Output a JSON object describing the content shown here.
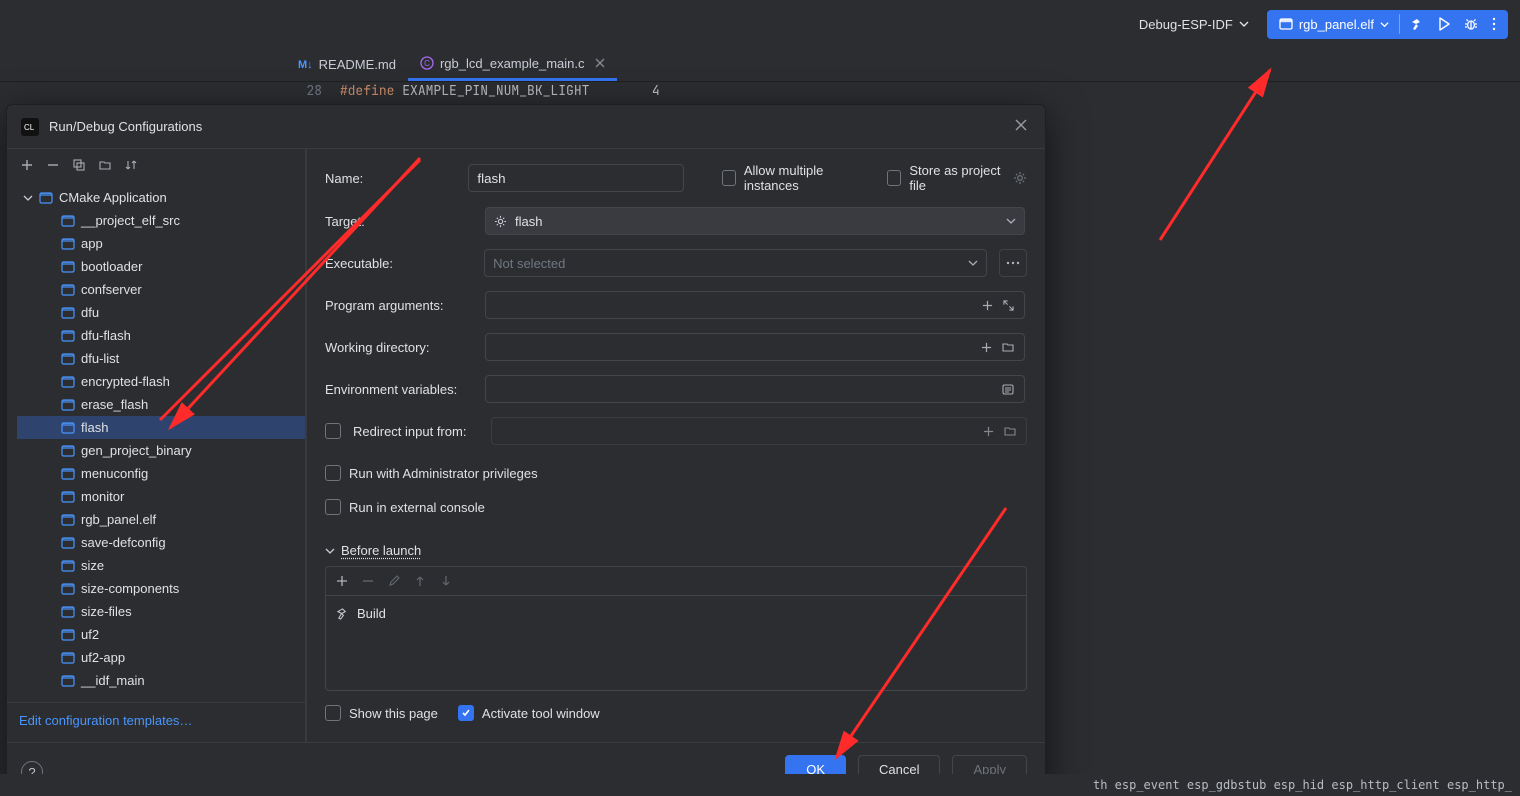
{
  "header": {
    "debug_config": "Debug-ESP-IDF",
    "run_target": "rgb_panel.elf"
  },
  "tabs": [
    {
      "icon": "md",
      "label": "README.md",
      "active": false,
      "closable": false
    },
    {
      "icon": "c",
      "label": "rgb_lcd_example_main.c",
      "active": true,
      "closable": true
    }
  ],
  "code": {
    "line_no": "28",
    "keyword": "#define",
    "name": "EXAMPLE_PIN_NUM_BK_LIGHT",
    "value": "4"
  },
  "dialog": {
    "title": "Run/Debug Configurations",
    "tree_root": "CMake Application",
    "tree_items": [
      "__project_elf_src",
      "app",
      "bootloader",
      "confserver",
      "dfu",
      "dfu-flash",
      "dfu-list",
      "encrypted-flash",
      "erase_flash",
      "flash",
      "gen_project_binary",
      "menuconfig",
      "monitor",
      "rgb_panel.elf",
      "save-defconfig",
      "size",
      "size-components",
      "size-files",
      "uf2",
      "uf2-app",
      "__idf_main"
    ],
    "more_item": "▾",
    "selected": "flash",
    "edit_templates": "Edit configuration templates…",
    "form": {
      "name_label": "Name:",
      "name_value": "flash",
      "allow_multi": "Allow multiple instances",
      "store_project": "Store as project file",
      "target_label": "Target:",
      "target_value": "flash",
      "executable_label": "Executable:",
      "executable_placeholder": "Not selected",
      "prog_args_label": "Program arguments:",
      "workdir_label": "Working directory:",
      "env_label": "Environment variables:",
      "redirect_label": "Redirect input from:",
      "run_admin": "Run with Administrator privileges",
      "run_ext": "Run in external console",
      "before_launch": "Before launch",
      "build_item": "Build",
      "show_page": "Show this page",
      "activate_window": "Activate tool window"
    },
    "buttons": {
      "ok": "OK",
      "cancel": "Cancel",
      "apply": "Apply"
    }
  },
  "statusbar": "th  esp_event  esp_gdbstub  esp_hid  esp_http_client  esp_http_"
}
